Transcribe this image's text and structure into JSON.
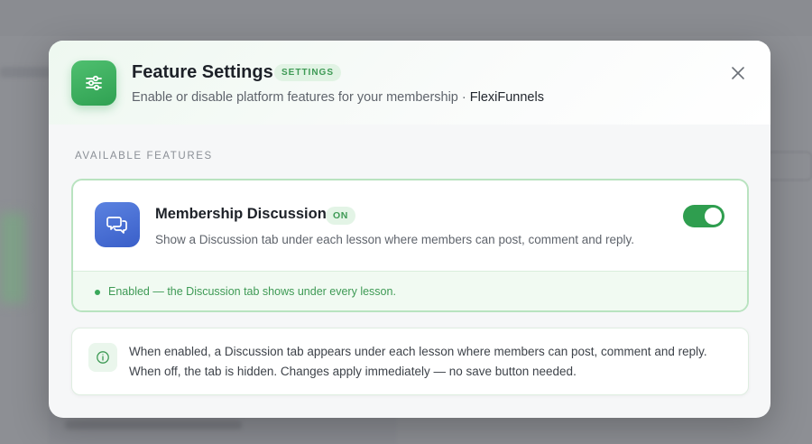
{
  "header": {
    "title": "Feature Settings",
    "badge": "SETTINGS",
    "subtitle": "Enable or disable platform features for your membership · ",
    "brand": "FlexiFunnels",
    "icon": "sliders-icon",
    "accent": "#2fa152"
  },
  "section": {
    "label": "AVAILABLE FEATURES"
  },
  "feature": {
    "title": "Membership Discussion",
    "badge": "ON",
    "description": "Show a Discussion tab under each lesson where members can post, comment and reply.",
    "icon": "chat-bubbles-icon",
    "enabled": true,
    "status": "Enabled — the Discussion tab shows under every lesson."
  },
  "info": {
    "line1": "When enabled, a Discussion tab appears under each lesson where members can post, comment and reply.",
    "line2": "When off, the tab is hidden. Changes apply immediately — no save button needed.",
    "icon": "info-icon"
  }
}
